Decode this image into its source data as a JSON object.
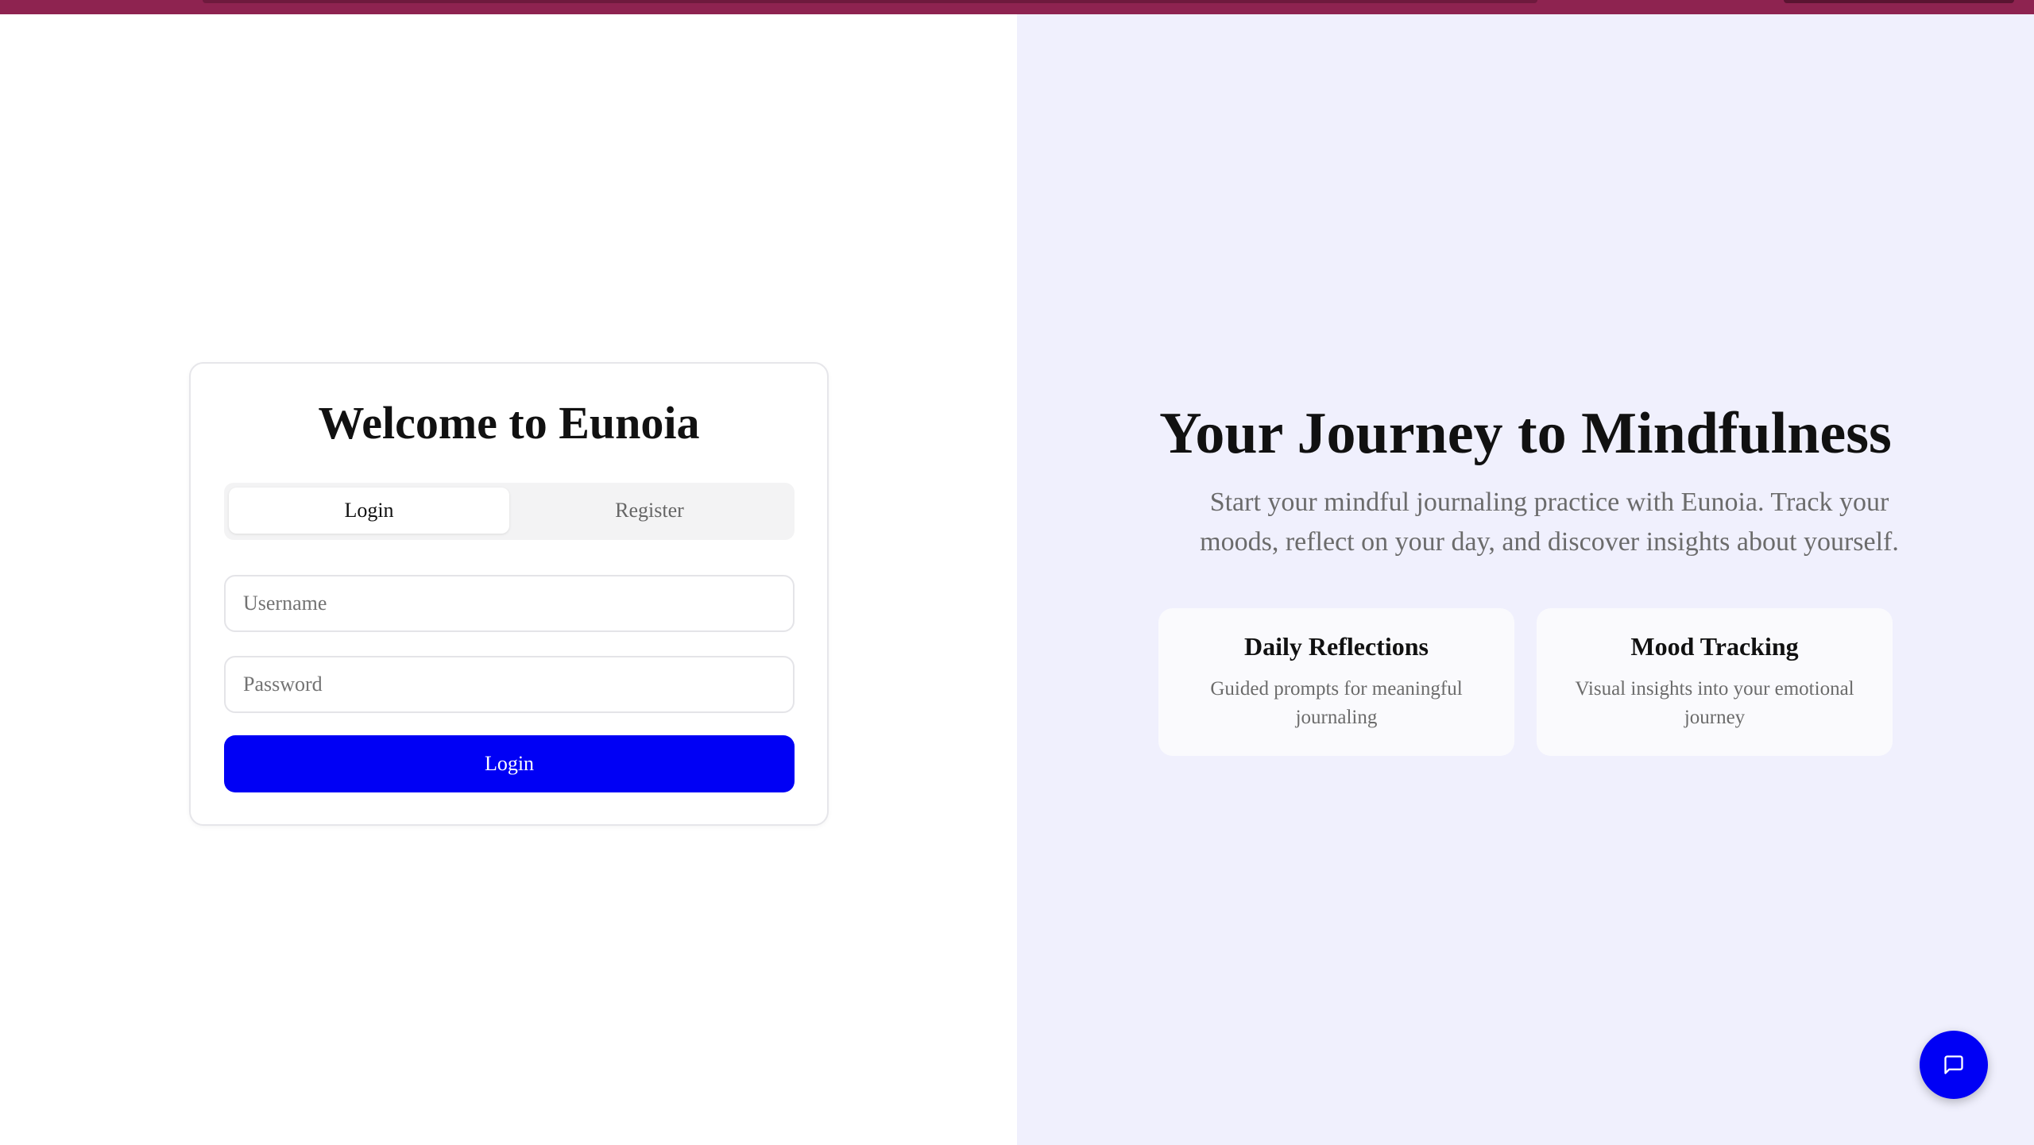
{
  "login_card": {
    "title": "Welcome to Eunoia",
    "tabs": [
      {
        "label": "Login",
        "active": true
      },
      {
        "label": "Register",
        "active": false
      }
    ],
    "username_placeholder": "Username",
    "password_placeholder": "Password",
    "submit_label": "Login"
  },
  "hero": {
    "title": "Your Journey to Mindfulness",
    "subtitle": "Start your mindful journaling practice with Eunoia. Track your moods, reflect on your day, and discover insights about yourself.",
    "features": [
      {
        "title": "Daily Reflections",
        "description": "Guided prompts for meaningful journaling"
      },
      {
        "title": "Mood Tracking",
        "description": "Visual insights into your emotional journey"
      }
    ]
  },
  "chat_button": {
    "icon": "chat-bubble-icon"
  },
  "colors": {
    "top_bar": "#8e2350",
    "primary": "#0000f5",
    "right_pane_bg": "#f0f0fd"
  }
}
